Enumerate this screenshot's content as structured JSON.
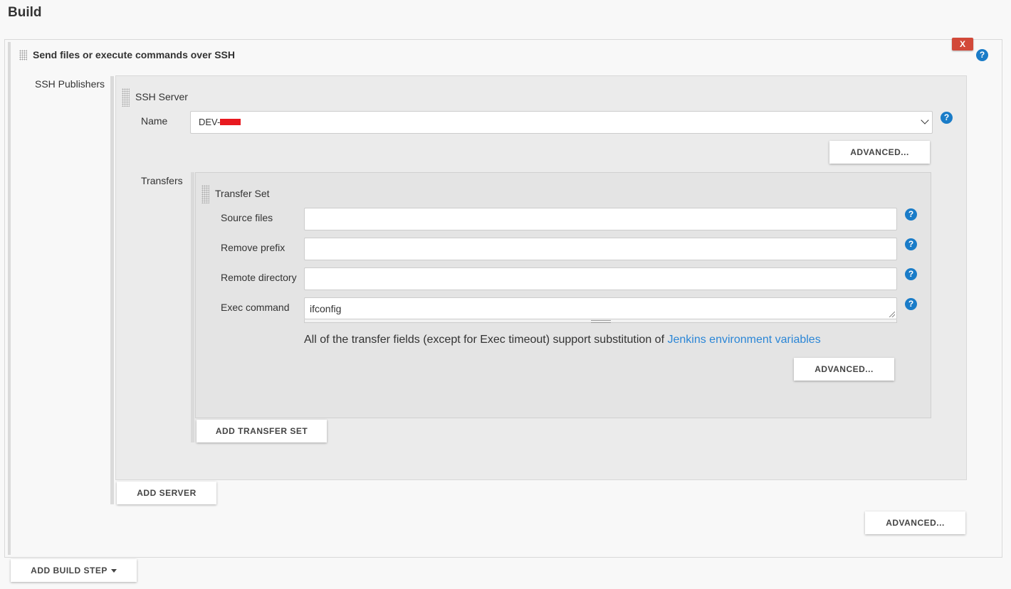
{
  "section_title": "Build",
  "build_step": {
    "title": "Send files or execute commands over SSH",
    "close_label": "X",
    "help_label": "?",
    "publishers_label": "SSH Publishers",
    "ssh_server": {
      "header": "SSH Server",
      "name_label": "Name",
      "name_value": "DEV-",
      "advanced_label": "ADVANCED...",
      "transfers_label": "Transfers",
      "transfer_set": {
        "header": "Transfer Set",
        "source_files_label": "Source files",
        "source_files_value": "",
        "remove_prefix_label": "Remove prefix",
        "remove_prefix_value": "",
        "remote_directory_label": "Remote directory",
        "remote_directory_value": "",
        "exec_command_label": "Exec command",
        "exec_command_value": "ifconfig",
        "note_text": "All of the transfer fields (except for Exec timeout) support substitution of ",
        "note_link": "Jenkins environment variables",
        "advanced_label": "ADVANCED..."
      },
      "add_transfer_set_label": "ADD TRANSFER SET"
    },
    "add_server_label": "ADD SERVER",
    "advanced_label": "ADVANCED..."
  },
  "add_build_step_label": "ADD BUILD STEP",
  "colors": {
    "accent_link": "#2b86d6",
    "help_icon": "#1a7cc8",
    "close_button": "#d24939",
    "redaction": "#e8191f"
  }
}
